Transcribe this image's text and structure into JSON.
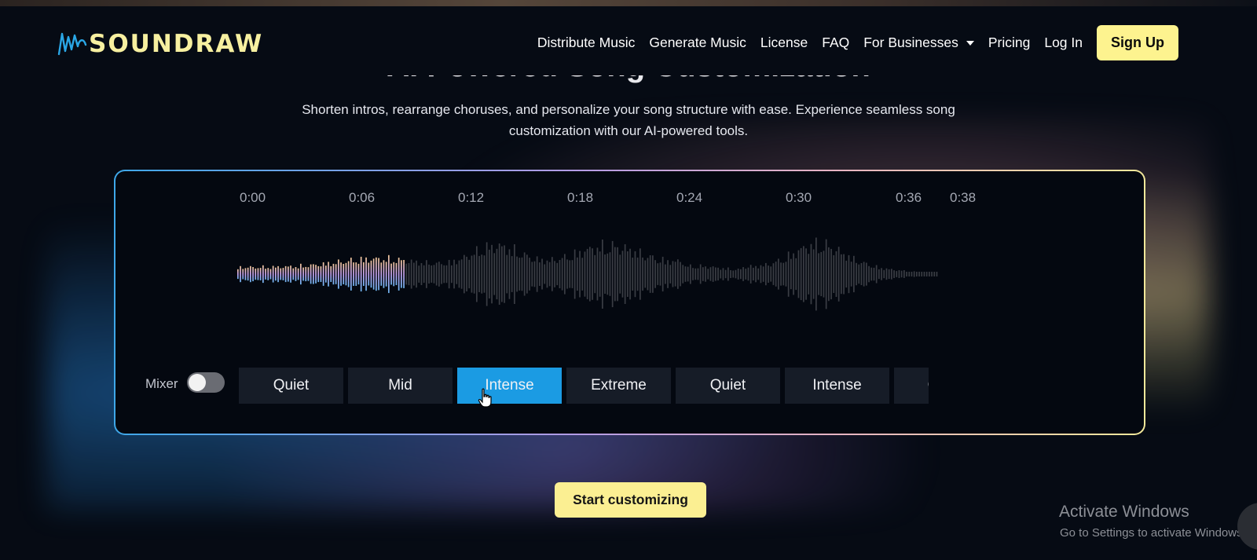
{
  "brand": {
    "name": "SOUNDRAW",
    "logo_color": "#f7f0a0",
    "accent_blue": "#2aa7e6"
  },
  "nav": {
    "items": [
      "Distribute Music",
      "Generate Music",
      "License",
      "FAQ"
    ],
    "dropdown_label": "For Businesses",
    "pricing": "Pricing",
    "login": "Log In",
    "signup": "Sign Up"
  },
  "hero": {
    "title": "AI Powered Song Customization",
    "subtitle": "Shorten intros, rearrange choruses, and personalize your song structure with ease. Experience seamless song customization with our AI-powered tools."
  },
  "editor": {
    "timeline": [
      "0:00",
      "0:06",
      "0:12",
      "0:18",
      "0:24",
      "0:30",
      "0:36",
      "0:38"
    ],
    "playback_progress": 0.24,
    "mixer_label": "Mixer",
    "mixer_on": false,
    "segments": [
      {
        "label": "Quiet",
        "active": false
      },
      {
        "label": "Mid",
        "active": false
      },
      {
        "label": "Intense",
        "active": true
      },
      {
        "label": "Extreme",
        "active": false
      },
      {
        "label": "Quiet",
        "active": false
      },
      {
        "label": "Intense",
        "active": false
      },
      {
        "label": "Outro",
        "active": false
      }
    ],
    "colors": {
      "active_segment": "#1b9be3",
      "segment_bg": "#161c27",
      "played_wave": [
        "#f2c79a",
        "#c7a4f0",
        "#6fb6f2"
      ],
      "unplayed_wave": "#3a3d44"
    }
  },
  "cta": {
    "label": "Start customizing"
  },
  "watermark": {
    "line1": "Activate Windows",
    "line2": "Go to Settings to activate Windows."
  }
}
